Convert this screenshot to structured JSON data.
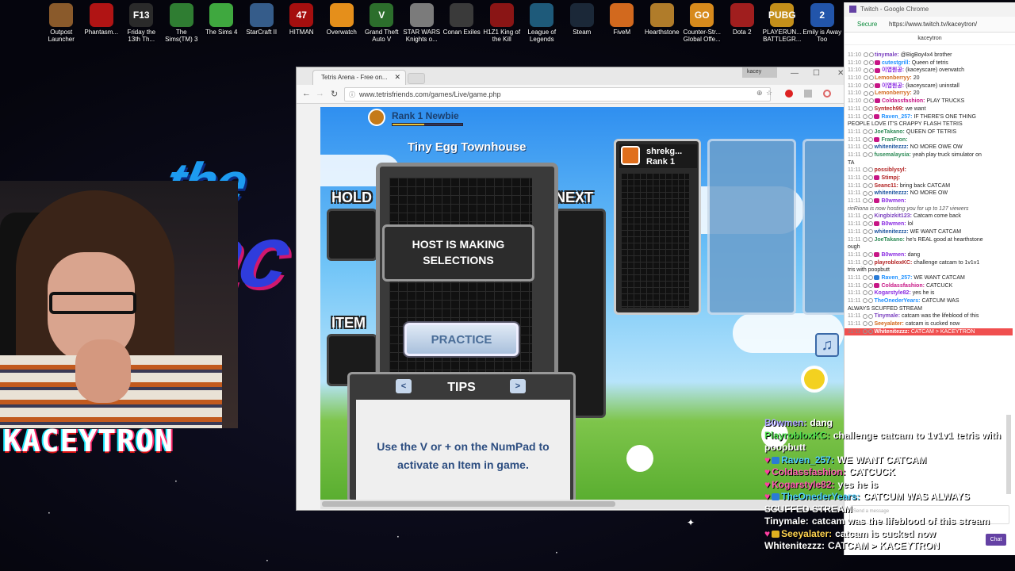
{
  "desktop": {
    "icons": [
      {
        "label": "Outpost Launcher",
        "glyph": "",
        "color": "#8a5a2b"
      },
      {
        "label": "Phantasm...",
        "glyph": "",
        "color": "#b01414"
      },
      {
        "label": "Friday the 13th Th...",
        "glyph": "F13",
        "color": "#2a2a2a"
      },
      {
        "label": "The Sims(TM) 3",
        "glyph": "",
        "color": "#2f7d32"
      },
      {
        "label": "The Sims 4",
        "glyph": "",
        "color": "#3fa83f"
      },
      {
        "label": "StarCraft II",
        "glyph": "",
        "color": "#355c8a"
      },
      {
        "label": "HITMAN",
        "glyph": "47",
        "color": "#a50f0f"
      },
      {
        "label": "Overwatch",
        "glyph": "",
        "color": "#e58f1b"
      },
      {
        "label": "Grand Theft Auto V",
        "glyph": "V",
        "color": "#2c6e2c"
      },
      {
        "label": "STAR WARS Knights o...",
        "glyph": "",
        "color": "#7b7b7b"
      },
      {
        "label": "Conan Exiles",
        "glyph": "",
        "color": "#3a3a3a"
      },
      {
        "label": "H1Z1 King of the Kill",
        "glyph": "",
        "color": "#8a1515"
      },
      {
        "label": "League of Legends",
        "glyph": "",
        "color": "#1e5a7a"
      },
      {
        "label": "Steam",
        "glyph": "",
        "color": "#1b2838"
      },
      {
        "label": "FiveM",
        "glyph": "",
        "color": "#d2691e"
      },
      {
        "label": "Hearthstone",
        "glyph": "",
        "color": "#b07c2a"
      },
      {
        "label": "Counter-Str... Global Offe...",
        "glyph": "GO",
        "color": "#d78a1c"
      },
      {
        "label": "Dota 2",
        "glyph": "",
        "color": "#a01e1e"
      },
      {
        "label": "PLAYERUN... BATTLEGR...",
        "glyph": "PUBG",
        "color": "#c48f1a"
      },
      {
        "label": "Emily is Away Too",
        "glyph": "2",
        "color": "#2255aa"
      }
    ]
  },
  "stream_overlay": {
    "brand_word_1": "the",
    "brand_word_2": "kac",
    "streamer_label": "KACEYTRON"
  },
  "browser": {
    "tab_title": "Tetris Arena - Free on...",
    "user_chip": "kacey",
    "url": "www.tetrisfriends.com/games/Live/game.php",
    "nav_back": "←",
    "nav_forward": "→",
    "nav_reload": "↻",
    "lock_glyph": "ⓘ",
    "zoom_glyph": "⊕",
    "star_glyph": "☆",
    "menu_glyph": "⋮",
    "min_glyph": "—",
    "max_glyph": "☐",
    "close_glyph": "✕",
    "tab_close": "✕"
  },
  "game": {
    "rank_title": "Rank 1 Newbie",
    "rank_progress": 0.45,
    "room_name": "Tiny Egg Townhouse",
    "hold_label": "HOLD",
    "next_label": "NEXT",
    "item_label": "ITEM",
    "host_message": "HOST IS MAKING SELECTIONS",
    "practice_button": "PRACTICE",
    "tips_title": "TIPS",
    "tips_prev": "<",
    "tips_next": ">",
    "tips_text": "Use the V or + on the NumPad to activate an Item in game.",
    "opponent_name": "shrekg...",
    "opponent_rank": "Rank 1",
    "music_glyph": "♫"
  },
  "chat_window": {
    "app_title": "Twitch - Google Chrome",
    "secure_label": "Secure",
    "url": "https://www.twitch.tv/kaceytron/",
    "channel": "kaceytron",
    "input_placeholder": "Send a message",
    "chat_button": "Chat",
    "messages": [
      {
        "ts": "11:10",
        "user": "tinymale:",
        "color": "#7a3fbf",
        "badge": "",
        "text": "@BigBoy4x4 brother"
      },
      {
        "ts": "11:10",
        "user": "cutestgrill:",
        "color": "#1e90ff",
        "badge": "#c71585",
        "text": "Queen of tetris"
      },
      {
        "ts": "11:10",
        "user": "이엽원공:",
        "color": "#8a2be2",
        "badge": "#c71585",
        "text": "(kaceyscare) overwatch"
      },
      {
        "ts": "11:10",
        "user": "Lemonberryy:",
        "color": "#d2691e",
        "badge": "",
        "text": "20"
      },
      {
        "ts": "11:10",
        "user": "이엽원공:",
        "color": "#8a2be2",
        "badge": "#c71585",
        "text": "(kaceyscare) uninstall"
      },
      {
        "ts": "11:10",
        "user": "Lemonberryy:",
        "color": "#d2691e",
        "badge": "",
        "text": "20"
      },
      {
        "ts": "11:10",
        "user": "Coldassfashion:",
        "color": "#c71585",
        "badge": "#c71585",
        "text": "PLAY TRUCKS"
      },
      {
        "ts": "11:11",
        "user": "Syntech99:",
        "color": "#b22222",
        "badge": "",
        "text": "we want"
      },
      {
        "ts": "11:11",
        "user": "Raven_257:",
        "color": "#1e90ff",
        "badge": "#c71585",
        "text": "IF THERE'S ONE THING"
      },
      {
        "ts": "",
        "user": "",
        "color": "#222",
        "badge": "",
        "text": "PEOPLE LOVE IT'S CRAPPY FLASH TETRIS"
      },
      {
        "ts": "11:11",
        "user": "JoeTakano:",
        "color": "#2e8b57",
        "badge": "",
        "text": "QUEEN OF TETRIS"
      },
      {
        "ts": "11:11",
        "user": "FranFron:",
        "color": "#2e8b57",
        "badge": "#c71585",
        "text": ""
      },
      {
        "ts": "11:11",
        "user": "whitenitezzz:",
        "color": "#1e56a0",
        "badge": "",
        "text": "NO MORE OWE OW"
      },
      {
        "ts": "11:11",
        "user": "fusemalaysia:",
        "color": "#2e8b57",
        "badge": "",
        "text": "yeah play truck simulator on"
      },
      {
        "ts": "",
        "user": "",
        "color": "#222",
        "badge": "",
        "text": "TA"
      },
      {
        "ts": "11:11",
        "user": "possiblysyl:",
        "color": "#b22222",
        "badge": "",
        "text": ""
      },
      {
        "ts": "11:11",
        "user": "Stimpj:",
        "color": "#b22222",
        "badge": "#c71585",
        "text": ""
      },
      {
        "ts": "11:11",
        "user": "Seanc11:",
        "color": "#b22222",
        "badge": "",
        "text": "bring back CATCAM"
      },
      {
        "ts": "11:11",
        "user": "whitenitezzz:",
        "color": "#1e56a0",
        "badge": "",
        "text": "NO MORE OW"
      },
      {
        "ts": "11:11",
        "user": "B0wmen:",
        "color": "#8a2be2",
        "badge": "#c71585",
        "text": ""
      },
      {
        "ts": "",
        "user": "",
        "color": "#555",
        "badge": "",
        "text": "rinRiona is now hosting you for up to 127 viewers"
      },
      {
        "ts": "11:11",
        "user": "Kingbizkit123:",
        "color": "#7a3fbf",
        "badge": "",
        "text": "Catcam come back"
      },
      {
        "ts": "11:11",
        "user": "B0wmen:",
        "color": "#8a2be2",
        "badge": "#c71585",
        "text": "lol"
      },
      {
        "ts": "11:11",
        "user": "whitenitezzz:",
        "color": "#1e56a0",
        "badge": "",
        "text": "WE WANT CATCAM"
      },
      {
        "ts": "11:11",
        "user": "JoeTakano:",
        "color": "#2e8b57",
        "badge": "",
        "text": "he's REAL good at hearthstone"
      },
      {
        "ts": "",
        "user": "",
        "color": "#222",
        "badge": "",
        "text": "ough"
      },
      {
        "ts": "11:11",
        "user": "B0wmen:",
        "color": "#8a2be2",
        "badge": "#c71585",
        "text": "dang"
      },
      {
        "ts": "11:11",
        "user": "playrobloxKC:",
        "color": "#b22222",
        "badge": "",
        "text": "challenge catcam to 1v1v1"
      },
      {
        "ts": "",
        "user": "",
        "color": "#222",
        "badge": "",
        "text": "tris with poopbutt"
      },
      {
        "ts": "11:11",
        "user": "Raven_257:",
        "color": "#1e90ff",
        "badge": "#2a7bd6",
        "text": "WE WANT CATCAM"
      },
      {
        "ts": "11:11",
        "user": "Coldassfashion:",
        "color": "#c71585",
        "badge": "#c71585",
        "text": "CATCUCK"
      },
      {
        "ts": "11:11",
        "user": "Kogarstyle82:",
        "color": "#8a2be2",
        "badge": "",
        "text": "yes he is"
      },
      {
        "ts": "11:11",
        "user": "TheOnederYears:",
        "color": "#1e90ff",
        "badge": "",
        "text": "CATCUM WAS"
      },
      {
        "ts": "",
        "user": "",
        "color": "#222",
        "badge": "",
        "text": "ALWAYS SCUFFED STREAM"
      },
      {
        "ts": "11:11",
        "user": "Tinymale:",
        "color": "#7a3fbf",
        "badge": "",
        "text": "catcam was the lifeblood of this"
      },
      {
        "ts": "11:11",
        "user": "Seeyalater:",
        "color": "#d2691e",
        "badge": "",
        "text": "catcam is cucked now"
      },
      {
        "ts": "11:11",
        "user": "Whitenitezzz:",
        "color": "#fff",
        "badge": "",
        "text": "CATCAM > KACEYTRON",
        "highlight": true
      }
    ]
  },
  "overlay_chat": [
    {
      "user": "B0wmen:",
      "color": "#b0aaff",
      "badge": "",
      "text": "dang"
    },
    {
      "user": "PlayrobloxKC:",
      "color": "#4fe34f",
      "badge": "",
      "text": "challenge catcam to 1v1v1 tetris with"
    },
    {
      "user": "",
      "color": "#fff",
      "badge": "",
      "text": "poopbutt"
    },
    {
      "user": "Raven_257:",
      "color": "#4fd0ff",
      "badge": "#2a7bd6",
      "heart": true,
      "text": "WE WANT CATCAM"
    },
    {
      "user": "Coldassfashion:",
      "color": "#ff5fb1",
      "badge": "",
      "heart": true,
      "text": "CATCUCK"
    },
    {
      "user": "Kogarstyle82:",
      "color": "#ff5fb1",
      "badge": "",
      "heart": true,
      "text": "yes he is"
    },
    {
      "user": "TheOnederYears:",
      "color": "#4fd0ff",
      "badge": "#2a7bd6",
      "heart": true,
      "text": "CATCUM WAS ALWAYS"
    },
    {
      "user": "",
      "color": "#fff",
      "badge": "",
      "text": "SCUFFED STREAM"
    },
    {
      "user": "Tinymale:",
      "color": "#fff",
      "badge": "",
      "text": "catcam was the lifeblood of this stream"
    },
    {
      "user": "Seeyalater:",
      "color": "#ffd34f",
      "badge": "#e0b020",
      "heart": true,
      "text": "catcam is cucked now"
    },
    {
      "user": "Whitenitezzz:",
      "color": "#fff",
      "badge": "",
      "text": "CATCAM > KACEYTRON"
    }
  ]
}
